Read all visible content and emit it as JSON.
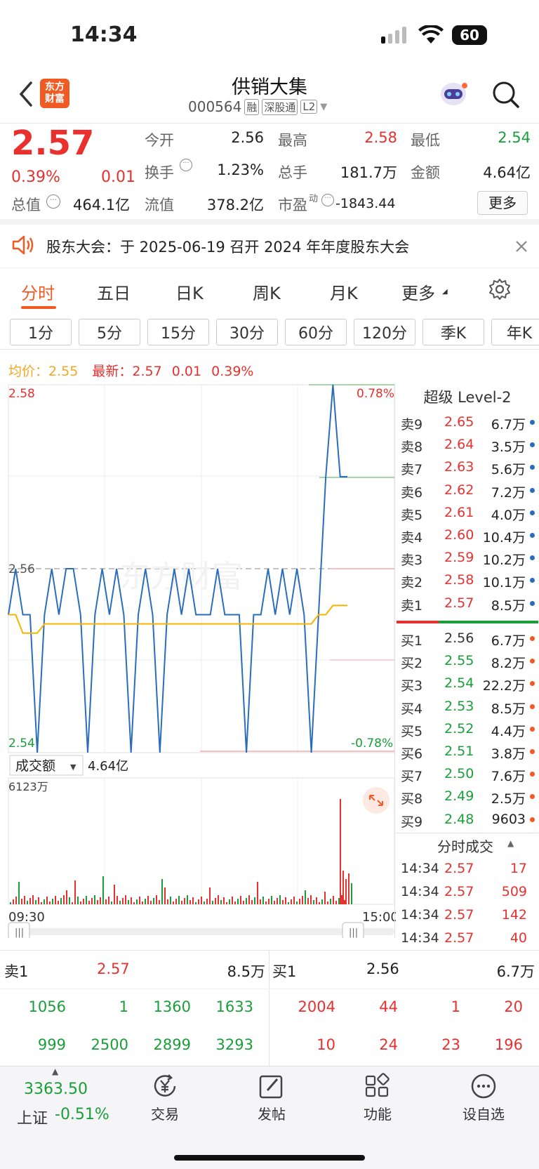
{
  "status": {
    "time": "14:34",
    "battery": "60"
  },
  "header": {
    "title": "供销大集",
    "code": "000564",
    "tags": [
      "融",
      "深股通",
      "L2"
    ],
    "logo_line1": "东方",
    "logo_line2": "财富"
  },
  "quote": {
    "price": "2.57",
    "pct": "0.39%",
    "chg": "0.01",
    "open_label": "今开",
    "open": "2.56",
    "high_label": "最高",
    "high": "2.58",
    "low_label": "最低",
    "low": "2.54",
    "turnover_label": "换手",
    "turnover": "1.23%",
    "volume_label": "总手",
    "volume": "181.7万",
    "amount_label": "金额",
    "amount": "4.64亿",
    "mcap_label": "总值",
    "mcap": "464.1亿",
    "float_label": "流值",
    "float": "378.2亿",
    "pe_label": "市盈",
    "pe_sup": "动",
    "pe": "-1843.44",
    "more": "更多"
  },
  "notice": {
    "text": "股东大会：于 2025-06-19 召开 2024 年年度股东大会"
  },
  "tabs": [
    "分时",
    "五日",
    "日K",
    "周K",
    "月K",
    "更多"
  ],
  "subtabs": [
    "1分",
    "5分",
    "15分",
    "30分",
    "60分",
    "120分",
    "季K",
    "年K"
  ],
  "info": {
    "avg_label": "均价：",
    "avg": "2.55",
    "latest_label": "最新：",
    "latest": "2.57",
    "chg": "0.01",
    "pct": "0.39%"
  },
  "chart": {
    "y_top": "2.58",
    "y_mid": "2.56",
    "y_bot": "2.54",
    "pct_top": "0.78%",
    "pct_bot": "-0.78%",
    "watermark": "东方财富",
    "vol_label": "成交额",
    "vol_total": "4.64亿",
    "vol_max": "6123万",
    "t_start": "09:30",
    "t_end": "15:00"
  },
  "chart_data": {
    "type": "line",
    "xlabel": "",
    "ylabel": "",
    "ylim": [
      2.54,
      2.58
    ],
    "series": [
      {
        "name": "最新",
        "values": [
          2.555,
          2.56,
          2.555,
          2.555,
          2.54,
          2.555,
          2.56,
          2.555,
          2.56,
          2.56,
          2.555,
          2.54,
          2.555,
          2.56,
          2.555,
          2.56,
          2.555,
          2.54,
          2.555,
          2.56,
          2.555,
          2.54,
          2.555,
          2.56,
          2.555,
          2.56,
          2.555,
          2.555,
          2.555,
          2.56,
          2.555,
          2.555,
          2.555,
          2.54,
          2.555,
          2.555,
          2.56,
          2.555,
          2.56,
          2.555,
          2.56,
          2.555,
          2.54,
          2.555,
          2.57,
          2.58,
          2.57,
          2.57
        ]
      },
      {
        "name": "均价",
        "values": [
          2.555,
          2.555,
          2.553,
          2.553,
          2.553,
          2.554,
          2.554,
          2.554,
          2.554,
          2.554,
          2.554,
          2.554,
          2.554,
          2.554,
          2.554,
          2.554,
          2.554,
          2.554,
          2.554,
          2.554,
          2.554,
          2.554,
          2.554,
          2.554,
          2.554,
          2.554,
          2.554,
          2.554,
          2.554,
          2.554,
          2.554,
          2.554,
          2.554,
          2.554,
          2.554,
          2.554,
          2.554,
          2.554,
          2.554,
          2.554,
          2.554,
          2.554,
          2.554,
          2.555,
          2.555,
          2.556,
          2.556,
          2.556
        ]
      }
    ]
  },
  "level2": {
    "title": "超级 Level-2",
    "asks": [
      {
        "label": "卖9",
        "price": "2.65",
        "vol": "6.7万"
      },
      {
        "label": "卖8",
        "price": "2.64",
        "vol": "3.5万"
      },
      {
        "label": "卖7",
        "price": "2.63",
        "vol": "5.6万"
      },
      {
        "label": "卖6",
        "price": "2.62",
        "vol": "7.2万"
      },
      {
        "label": "卖5",
        "price": "2.61",
        "vol": "4.0万"
      },
      {
        "label": "卖4",
        "price": "2.60",
        "vol": "10.4万"
      },
      {
        "label": "卖3",
        "price": "2.59",
        "vol": "10.2万"
      },
      {
        "label": "卖2",
        "price": "2.58",
        "vol": "10.1万"
      },
      {
        "label": "卖1",
        "price": "2.57",
        "vol": "8.5万"
      }
    ],
    "bids": [
      {
        "label": "买1",
        "price": "2.56",
        "vol": "6.7万"
      },
      {
        "label": "买2",
        "price": "2.55",
        "vol": "8.2万"
      },
      {
        "label": "买3",
        "price": "2.54",
        "vol": "22.2万"
      },
      {
        "label": "买4",
        "price": "2.53",
        "vol": "8.5万"
      },
      {
        "label": "买5",
        "price": "2.52",
        "vol": "4.4万"
      },
      {
        "label": "买6",
        "price": "2.51",
        "vol": "3.8万"
      },
      {
        "label": "买7",
        "price": "2.50",
        "vol": "7.6万"
      },
      {
        "label": "买8",
        "price": "2.49",
        "vol": "2.5万"
      },
      {
        "label": "买9",
        "price": "2.48",
        "vol": "9603"
      }
    ],
    "ticks_title": "分时成交",
    "ticks": [
      {
        "t": "14:34",
        "p": "2.57",
        "v": "17"
      },
      {
        "t": "14:34",
        "p": "2.57",
        "v": "509"
      },
      {
        "t": "14:34",
        "p": "2.57",
        "v": "142"
      },
      {
        "t": "14:34",
        "p": "2.57",
        "v": "40"
      }
    ]
  },
  "queue": {
    "sell_label": "卖1",
    "sell_price": "2.57",
    "sell_vol": "8.5万",
    "buy_label": "买1",
    "buy_price": "2.56",
    "buy_vol": "6.7万",
    "sell_row1": [
      "1056",
      "1",
      "1360",
      "1633"
    ],
    "sell_row2": [
      "999",
      "2500",
      "2899",
      "3293"
    ],
    "buy_row1": [
      "2004",
      "44",
      "1",
      "20"
    ],
    "buy_row2": [
      "10",
      "24",
      "23",
      "196"
    ]
  },
  "bottom": {
    "index_value": "3363.50",
    "index_name": "上证",
    "index_pct": "-0.51%",
    "nav": [
      "交易",
      "发帖",
      "功能",
      "设自选"
    ]
  }
}
